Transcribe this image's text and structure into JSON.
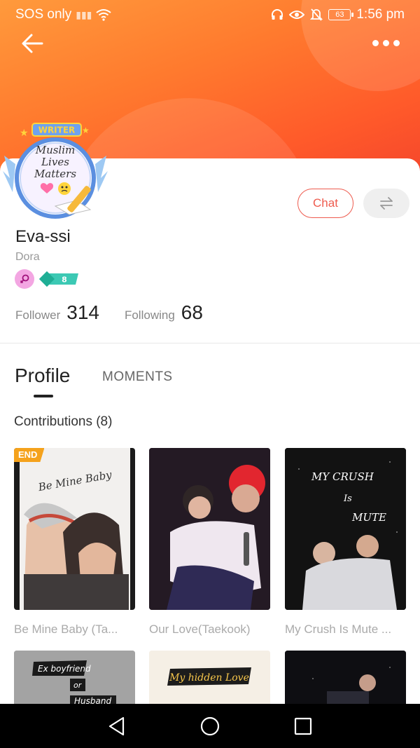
{
  "status_bar": {
    "carrier": "SOS only",
    "battery": "63",
    "time": "1:56 pm"
  },
  "avatar": {
    "badge": "WRITER",
    "lines": [
      "Muslim",
      "Lives",
      "Matters"
    ]
  },
  "profile": {
    "name": "Eva-ssi",
    "subname": "Dora",
    "level": "8",
    "chat_label": "Chat",
    "follower_label": "Follower",
    "follower_count": "314",
    "following_label": "Following",
    "following_count": "68"
  },
  "tabs": {
    "profile": "Profile",
    "moments": "MOMENTS"
  },
  "contributions": {
    "title": "Contributions (8)",
    "items": [
      {
        "title": "Be Mine Baby (Ta...",
        "cover_text": "Be Mine Baby",
        "badge": "END"
      },
      {
        "title": "Our Love(Taekook)"
      },
      {
        "title": "My Crush Is Mute ...",
        "cover_text": [
          "MY CRUSH",
          "Is",
          "MUTE"
        ]
      },
      {
        "cover_text": [
          "Ex boyfriend",
          "or",
          "Husband"
        ]
      },
      {
        "cover_text": "My hidden Love"
      },
      {}
    ]
  },
  "colors": {
    "accent": "#ee5b4e",
    "header_start": "#ff9a3c",
    "header_end": "#f4452c",
    "end_badge": "#f5a21c"
  },
  "icons": {
    "back": "arrow-left-icon",
    "more": "more-dots-icon",
    "switch": "swap-arrows-icon",
    "gender": "female-icon",
    "level": "level-badge-icon"
  }
}
